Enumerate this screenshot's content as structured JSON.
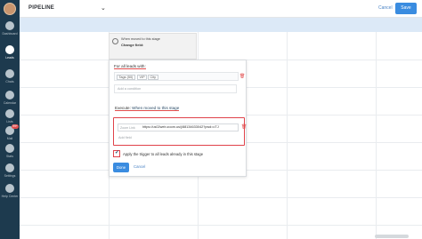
{
  "sidebar": {
    "items": [
      {
        "label": "Dashboard",
        "icon": "dashboard-icon"
      },
      {
        "label": "Leads",
        "icon": "leads-icon",
        "active": true
      },
      {
        "label": "Chats",
        "icon": "chats-icon"
      },
      {
        "label": "Calendar",
        "icon": "calendar-icon"
      },
      {
        "label": "Lists",
        "icon": "lists-icon"
      },
      {
        "label": "Mail",
        "icon": "mail-icon",
        "badge": "99+"
      },
      {
        "label": "Stats",
        "icon": "stats-icon"
      },
      {
        "label": "Settings",
        "icon": "settings-icon"
      },
      {
        "label": "Help Center",
        "icon": "help-icon"
      }
    ]
  },
  "topbar": {
    "title": "PIPELINE",
    "cancel_label": "Cancel",
    "save_label": "Save"
  },
  "trigger": {
    "line1": "When moved to this stage",
    "line2": "Change field:"
  },
  "panel": {
    "for_all_label": "For all leads with:",
    "chips": [
      "Tags (50)",
      "VIP",
      "City"
    ],
    "add_condition_placeholder": "Add a condition",
    "execute_label": "Execute:",
    "execute_value": "When moved to this stage",
    "zoom_field_label": "Zoom Link",
    "zoom_field_value": "https://us02web.zoom.us/j/88134633042?pwd=cTJ",
    "add_field_placeholder": "Add field",
    "apply_label": "Apply the trigger to all leads already in this stage",
    "apply_checked": true,
    "done_label": "Done",
    "cancel_label": "Cancel"
  },
  "colors": {
    "sidebar_bg": "#1d3a4e",
    "accent_blue": "#3a8ce0",
    "highlight_red": "#e0424a",
    "header_strip": "#dce9f7"
  }
}
